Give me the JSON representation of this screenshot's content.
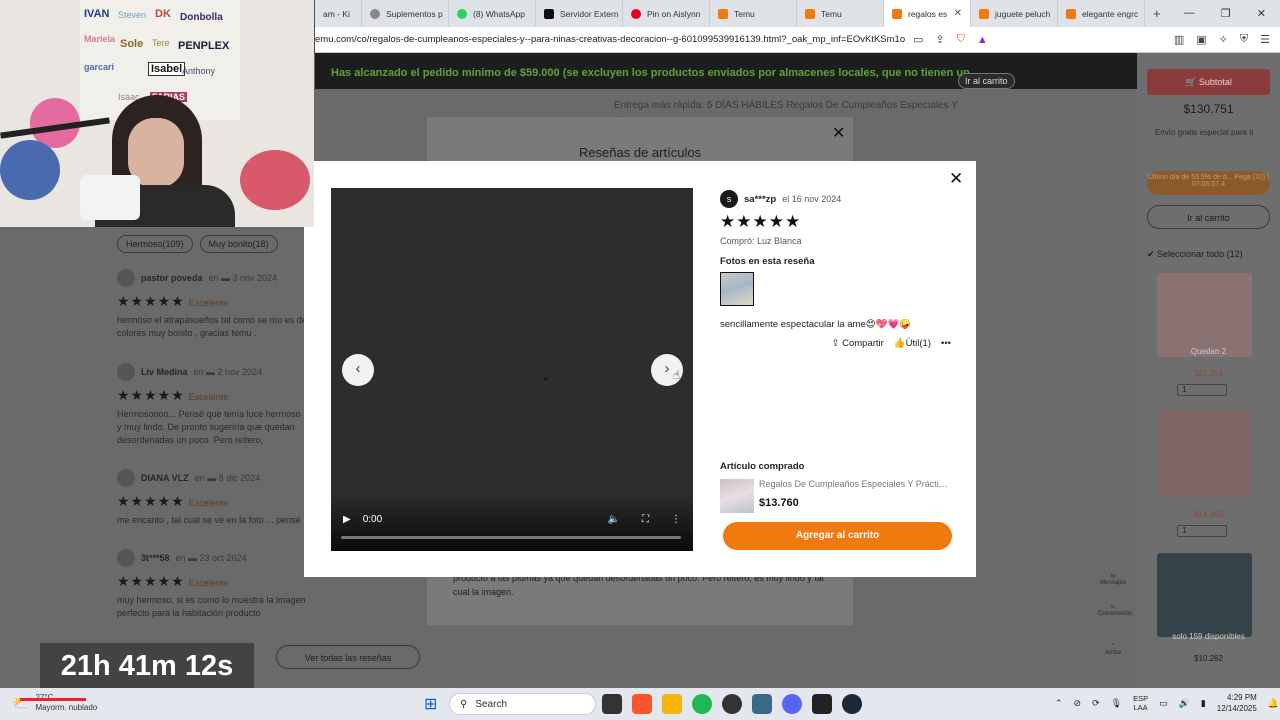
{
  "browser": {
    "tabs": [
      {
        "label": "am - Ki",
        "color": "#9a6a3a",
        "active": false
      },
      {
        "label": "Suplementos p",
        "color": "#888888",
        "active": false
      },
      {
        "label": "(8) WhatsApp",
        "color": "#25d366",
        "active": false
      },
      {
        "label": "Servidor Extern",
        "color": "#111111",
        "active": false
      },
      {
        "label": "Pin on Aislynn",
        "color": "#e60023",
        "active": false
      },
      {
        "label": "Temu",
        "color": "#f07a0e",
        "active": false
      },
      {
        "label": "Temu",
        "color": "#f07a0e",
        "active": false
      },
      {
        "label": "regalos es",
        "color": "#f07a0e",
        "active": true
      },
      {
        "label": "juguete peluch",
        "color": "#f07a0e",
        "active": false
      },
      {
        "label": "elegante engrc",
        "color": "#f07a0e",
        "active": false
      }
    ],
    "url": "emu.com/co/regalos-de-cumpleanos-especiales-y--para-ninas-creativas-decoracion--g-601099539916139.html?_oak_mp_inf=EOvKtKSm1og8..."
  },
  "page": {
    "banner": "Has alcanzado el pedido mínimo de $59.000 (se excluyen los productos enviados por almacenes locales, que no tienen un",
    "banner_button": "Ir al carrito",
    "delivery_text": "Entrega más rápida: 5 DÍAS HÁBILES Regalos De Cumpleaños Especiales Y",
    "delivery_text2": "ar",
    "chips": [
      "Hermoso(109)",
      "Muy bonito(18)"
    ],
    "bg_reviews": [
      {
        "name": "pastor poveda",
        "date": "en ▬ 3 nov 2024",
        "rating_label": "Excelente",
        "text": "hermoso el atrapasueños tal como se mu es de colores muy bonito , gracias temu ."
      },
      {
        "name": "Liv Medina",
        "date": "en ▬ 2 nov 2024",
        "rating_label": "Excelente",
        "text": "Hermosoooo... Pensé que tenía luce hermoso y muy lindo. De pronto sugeriría que quedan desordenadas un poco. Pero reitero,"
      },
      {
        "name": "DIANA VLZ",
        "date": "en ▬ 8 dic 2024",
        "rating_label": "Excelente",
        "text": "me encanto , tal cual se ve en la foto ... pensé"
      },
      {
        "name": "3t***58",
        "date": "en ▬ 23 oct 2024",
        "rating_label": "Excelente",
        "text": "muy hermoso, si es como lo muestra la imagen perfecto para la habitación producto"
      }
    ],
    "see_all": "Ver todas las reseñas",
    "modal_title": "Reseñas de artículos",
    "modal_footer": "producto a las plumas ya que quedan desordenadas un poco. Pero reitero, es muy lindo y tal cual la imagen."
  },
  "sidebar": {
    "subtotal_label": "Subtotal",
    "subtotal": "$130.751",
    "shipping": "Envío gratis especial para ti",
    "promo": "Último día de 53.5% de d... Pega (10) | 07:06:57.4",
    "cart_button": "Ir al carrito",
    "select_all": "Seleccionar todo (12)",
    "item1_tag": "Quedan 2",
    "price1": "$21.356",
    "qty1": "1",
    "price2": "$14.460",
    "qty2": "1",
    "item3_tag": "solo 159 disponibles",
    "price3": "$10.262",
    "icons": [
      "Mensajes",
      "Comentarios",
      "Arriba"
    ]
  },
  "review_modal": {
    "user_initial": "s",
    "user": "sa***zp",
    "date": "el 16 nov 2024",
    "stars": "★★★★★",
    "bought": "Compró: Luz Blanca",
    "photos_label": "Fotos en esta reseña",
    "text": "sencillamente espectacular la ame😍💖💗🤪",
    "share": "Compartir",
    "useful": "Útil(1)",
    "more": "•••",
    "purchased_label": "Artículo comprado",
    "product_name": "Regalos De Cumpleaños Especiales Y Práctic...",
    "product_price": "$13.760",
    "add_to_cart": "Agregar al carrito",
    "video_time": "0:00",
    "close": "✕",
    "prev": "‹",
    "next": "›"
  },
  "webcam": {
    "notes": [
      "IVAN",
      "Steven",
      "DK",
      "Donbolla",
      "Mariela",
      "Sole",
      "Tere",
      "PENPLEX",
      "garcari",
      "Isabel",
      "Anthony",
      "Isaac",
      "FARIAS"
    ]
  },
  "timer": "21h 41m 12s",
  "taskbar": {
    "weather_temp": "27°C",
    "weather_desc": "Mayorm. nublado",
    "search": "Search",
    "lang1": "ESP",
    "lang2": "LAA",
    "time": "4:29 PM",
    "date": "12/14/2025"
  }
}
